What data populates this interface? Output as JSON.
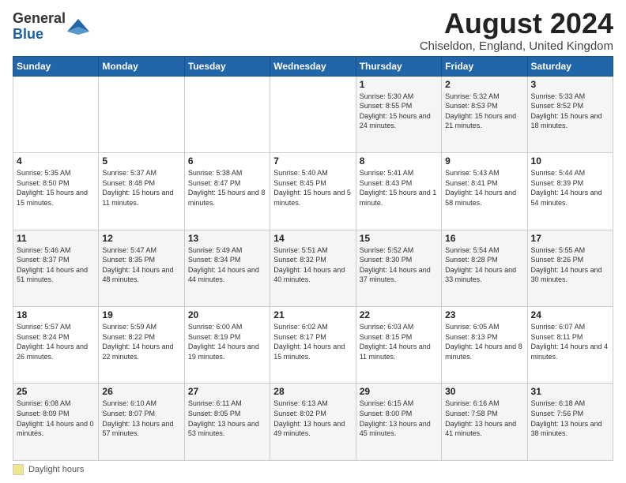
{
  "logo": {
    "general": "General",
    "blue": "Blue"
  },
  "title": "August 2024",
  "subtitle": "Chiseldon, England, United Kingdom",
  "days_of_week": [
    "Sunday",
    "Monday",
    "Tuesday",
    "Wednesday",
    "Thursday",
    "Friday",
    "Saturday"
  ],
  "footer_legend": "Daylight hours",
  "weeks": [
    [
      {
        "day": "",
        "info": ""
      },
      {
        "day": "",
        "info": ""
      },
      {
        "day": "",
        "info": ""
      },
      {
        "day": "",
        "info": ""
      },
      {
        "day": "1",
        "info": "Sunrise: 5:30 AM\nSunset: 8:55 PM\nDaylight: 15 hours and 24 minutes."
      },
      {
        "day": "2",
        "info": "Sunrise: 5:32 AM\nSunset: 8:53 PM\nDaylight: 15 hours and 21 minutes."
      },
      {
        "day": "3",
        "info": "Sunrise: 5:33 AM\nSunset: 8:52 PM\nDaylight: 15 hours and 18 minutes."
      }
    ],
    [
      {
        "day": "4",
        "info": "Sunrise: 5:35 AM\nSunset: 8:50 PM\nDaylight: 15 hours and 15 minutes."
      },
      {
        "day": "5",
        "info": "Sunrise: 5:37 AM\nSunset: 8:48 PM\nDaylight: 15 hours and 11 minutes."
      },
      {
        "day": "6",
        "info": "Sunrise: 5:38 AM\nSunset: 8:47 PM\nDaylight: 15 hours and 8 minutes."
      },
      {
        "day": "7",
        "info": "Sunrise: 5:40 AM\nSunset: 8:45 PM\nDaylight: 15 hours and 5 minutes."
      },
      {
        "day": "8",
        "info": "Sunrise: 5:41 AM\nSunset: 8:43 PM\nDaylight: 15 hours and 1 minute."
      },
      {
        "day": "9",
        "info": "Sunrise: 5:43 AM\nSunset: 8:41 PM\nDaylight: 14 hours and 58 minutes."
      },
      {
        "day": "10",
        "info": "Sunrise: 5:44 AM\nSunset: 8:39 PM\nDaylight: 14 hours and 54 minutes."
      }
    ],
    [
      {
        "day": "11",
        "info": "Sunrise: 5:46 AM\nSunset: 8:37 PM\nDaylight: 14 hours and 51 minutes."
      },
      {
        "day": "12",
        "info": "Sunrise: 5:47 AM\nSunset: 8:35 PM\nDaylight: 14 hours and 48 minutes."
      },
      {
        "day": "13",
        "info": "Sunrise: 5:49 AM\nSunset: 8:34 PM\nDaylight: 14 hours and 44 minutes."
      },
      {
        "day": "14",
        "info": "Sunrise: 5:51 AM\nSunset: 8:32 PM\nDaylight: 14 hours and 40 minutes."
      },
      {
        "day": "15",
        "info": "Sunrise: 5:52 AM\nSunset: 8:30 PM\nDaylight: 14 hours and 37 minutes."
      },
      {
        "day": "16",
        "info": "Sunrise: 5:54 AM\nSunset: 8:28 PM\nDaylight: 14 hours and 33 minutes."
      },
      {
        "day": "17",
        "info": "Sunrise: 5:55 AM\nSunset: 8:26 PM\nDaylight: 14 hours and 30 minutes."
      }
    ],
    [
      {
        "day": "18",
        "info": "Sunrise: 5:57 AM\nSunset: 8:24 PM\nDaylight: 14 hours and 26 minutes."
      },
      {
        "day": "19",
        "info": "Sunrise: 5:59 AM\nSunset: 8:22 PM\nDaylight: 14 hours and 22 minutes."
      },
      {
        "day": "20",
        "info": "Sunrise: 6:00 AM\nSunset: 8:19 PM\nDaylight: 14 hours and 19 minutes."
      },
      {
        "day": "21",
        "info": "Sunrise: 6:02 AM\nSunset: 8:17 PM\nDaylight: 14 hours and 15 minutes."
      },
      {
        "day": "22",
        "info": "Sunrise: 6:03 AM\nSunset: 8:15 PM\nDaylight: 14 hours and 11 minutes."
      },
      {
        "day": "23",
        "info": "Sunrise: 6:05 AM\nSunset: 8:13 PM\nDaylight: 14 hours and 8 minutes."
      },
      {
        "day": "24",
        "info": "Sunrise: 6:07 AM\nSunset: 8:11 PM\nDaylight: 14 hours and 4 minutes."
      }
    ],
    [
      {
        "day": "25",
        "info": "Sunrise: 6:08 AM\nSunset: 8:09 PM\nDaylight: 14 hours and 0 minutes."
      },
      {
        "day": "26",
        "info": "Sunrise: 6:10 AM\nSunset: 8:07 PM\nDaylight: 13 hours and 57 minutes."
      },
      {
        "day": "27",
        "info": "Sunrise: 6:11 AM\nSunset: 8:05 PM\nDaylight: 13 hours and 53 minutes."
      },
      {
        "day": "28",
        "info": "Sunrise: 6:13 AM\nSunset: 8:02 PM\nDaylight: 13 hours and 49 minutes."
      },
      {
        "day": "29",
        "info": "Sunrise: 6:15 AM\nSunset: 8:00 PM\nDaylight: 13 hours and 45 minutes."
      },
      {
        "day": "30",
        "info": "Sunrise: 6:16 AM\nSunset: 7:58 PM\nDaylight: 13 hours and 41 minutes."
      },
      {
        "day": "31",
        "info": "Sunrise: 6:18 AM\nSunset: 7:56 PM\nDaylight: 13 hours and 38 minutes."
      }
    ]
  ]
}
